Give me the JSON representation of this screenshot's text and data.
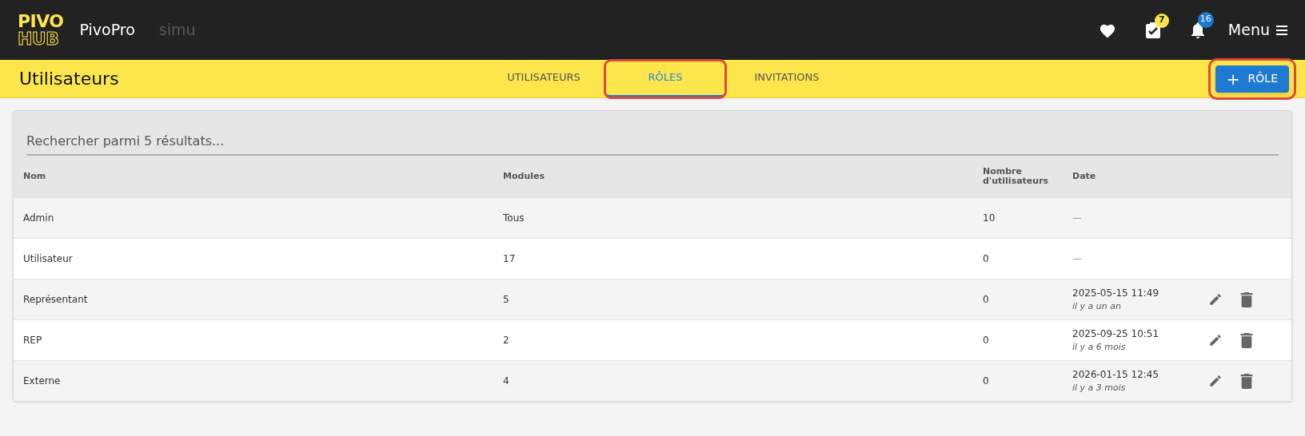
{
  "app_bar": {
    "logo_top": "PIVO",
    "logo_bottom": "HUB",
    "app_name": "PivoPro",
    "environment": "simu",
    "tasks_badge": "7",
    "notifications_badge": "16",
    "menu": "Menu"
  },
  "page_header": {
    "title": "Utilisateurs",
    "tabs": [
      {
        "label": "UTILISATEURS",
        "selected": false,
        "highlighted": false
      },
      {
        "label": "RÔLES",
        "selected": true,
        "highlighted": true
      },
      {
        "label": "INVITATIONS",
        "selected": false,
        "highlighted": false
      }
    ],
    "add_button": {
      "icon": "+",
      "label": "RÔLE",
      "highlighted": true
    }
  },
  "search": {
    "placeholder": "Rechercher parmi 5 résultats..."
  },
  "table": {
    "columns": [
      "Nom",
      "Modules",
      "Nombre d'utilisateurs",
      "Date"
    ],
    "rows": [
      {
        "name": "Admin",
        "modules": "Tous",
        "users": "10",
        "date": "—",
        "actions": false
      },
      {
        "name": "Utilisateur",
        "modules": "17",
        "users": "0",
        "date": "—",
        "actions": false
      },
      {
        "name": "Représentant",
        "modules": "5",
        "users": "0",
        "date": "2025-05-15 11:49",
        "relative": "il y a un an",
        "actions": true
      },
      {
        "name": "REP",
        "modules": "2",
        "users": "0",
        "date": "2025-09-25 10:51",
        "relative": "il y a 6 mois",
        "actions": true
      },
      {
        "name": "Externe",
        "modules": "4",
        "users": "0",
        "date": "2026-01-15 12:45",
        "relative": "il y a 3 mois",
        "actions": true
      }
    ]
  }
}
